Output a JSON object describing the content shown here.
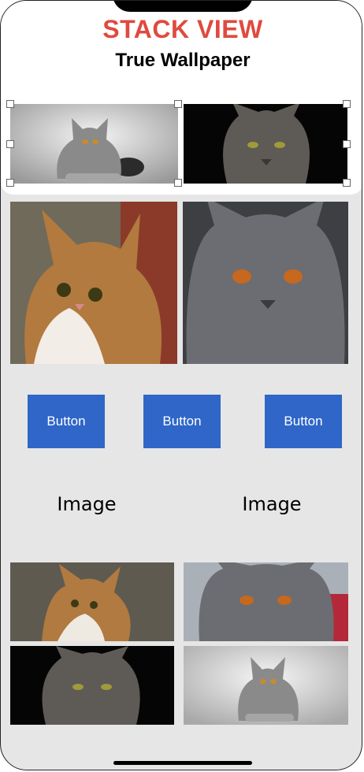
{
  "header": {
    "title": "STACK VIEW",
    "subtitle": "True Wallpaper"
  },
  "images": {
    "top_left": "gray-cat-lying-photo",
    "top_right": "dark-grumpy-cat-photo",
    "mid_left": "calico-longhair-cat-photo",
    "mid_right": "gray-british-shorthair-face-photo",
    "bottom_1": "calico-longhair-cat-photo",
    "bottom_2": "gray-british-shorthair-face-photo",
    "bottom_3": "dark-grumpy-cat-photo",
    "bottom_4": "gray-cat-lying-photo"
  },
  "buttons": [
    {
      "label": "Button"
    },
    {
      "label": "Button"
    },
    {
      "label": "Button"
    }
  ],
  "image_labels": [
    {
      "label": "Image"
    },
    {
      "label": "Image"
    }
  ],
  "colors": {
    "title_red": "#e04a3f",
    "button_blue": "#2f66c8",
    "background": "#e6e6e6"
  }
}
